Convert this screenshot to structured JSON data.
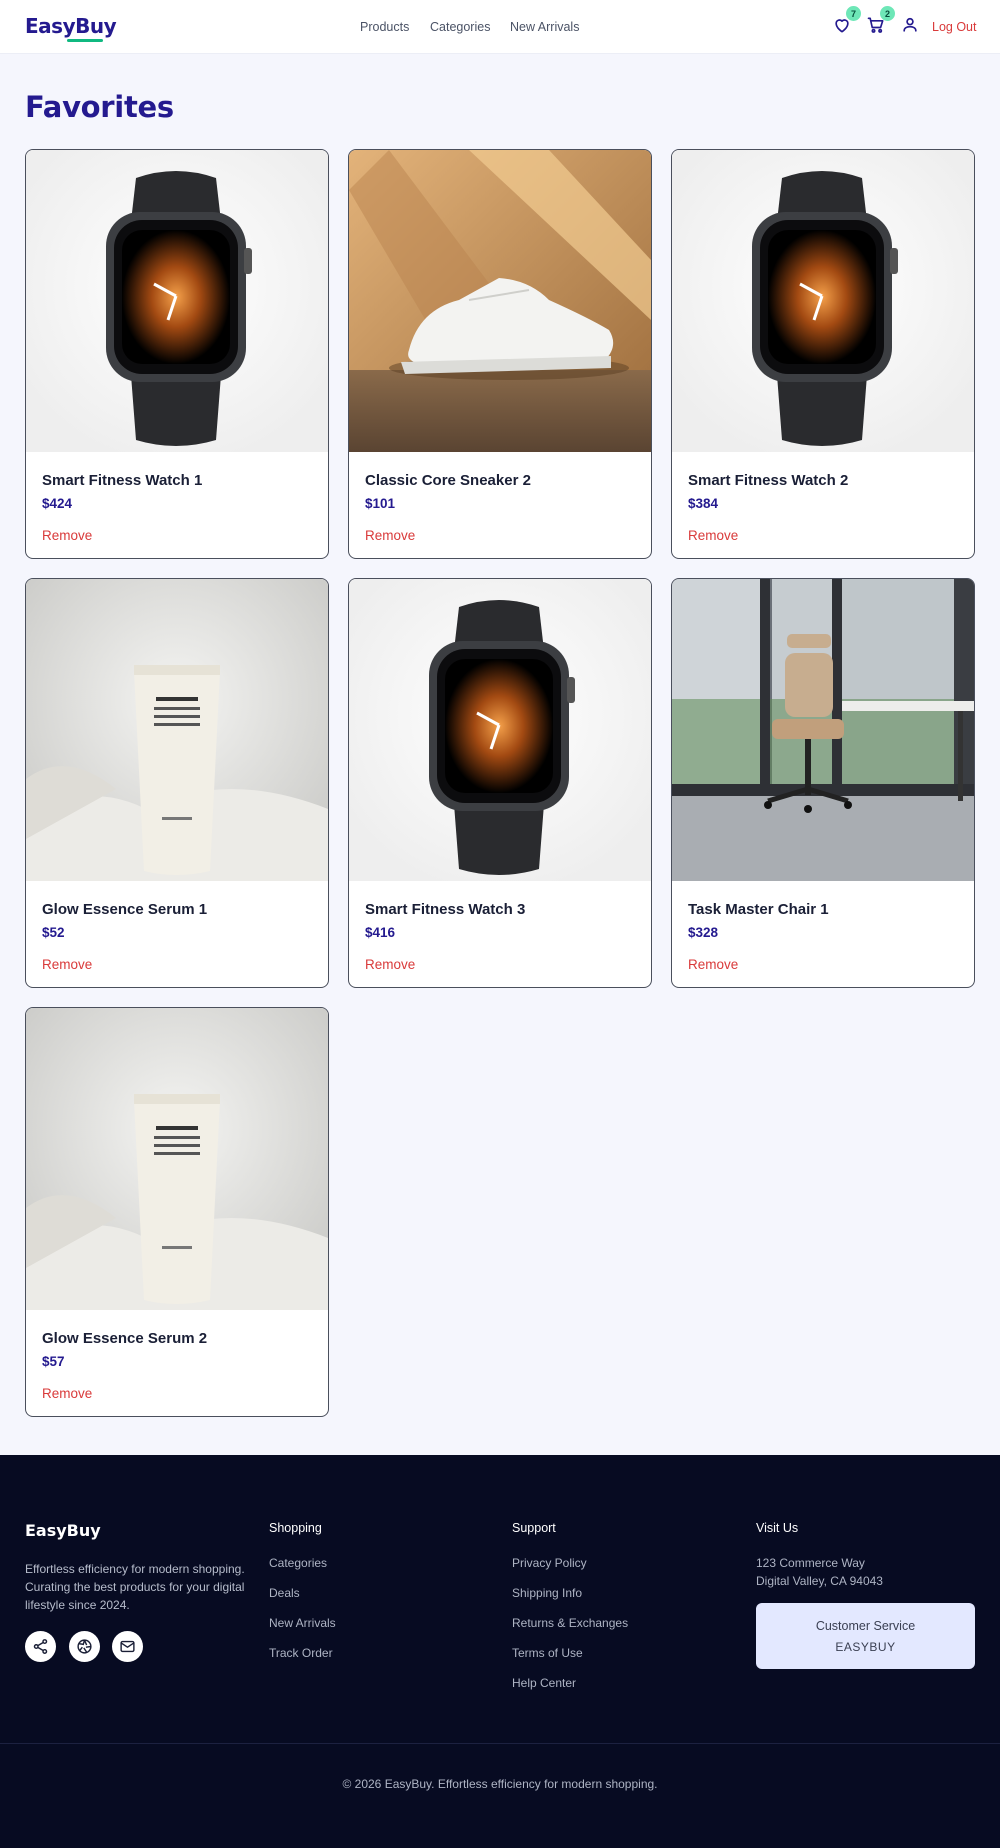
{
  "header": {
    "logo": "EasyBuy",
    "nav": [
      "Products",
      "Categories",
      "New Arrivals"
    ],
    "wishlist_count": "7",
    "cart_count": "2",
    "logout_label": "Log Out",
    "icons": [
      "heart-icon",
      "cart-icon",
      "user-icon"
    ]
  },
  "page": {
    "title": "Favorites"
  },
  "favorites": [
    {
      "name": "Smart Fitness Watch 1",
      "price": "$424",
      "remove": "Remove",
      "image": "watch"
    },
    {
      "name": "Classic Core Sneaker 2",
      "price": "$101",
      "remove": "Remove",
      "image": "sneaker"
    },
    {
      "name": "Smart Fitness Watch 2",
      "price": "$384",
      "remove": "Remove",
      "image": "watch"
    },
    {
      "name": "Glow Essence Serum 1",
      "price": "$52",
      "remove": "Remove",
      "image": "serum"
    },
    {
      "name": "Smart Fitness Watch 3",
      "price": "$416",
      "remove": "Remove",
      "image": "watch"
    },
    {
      "name": "Task Master Chair 1",
      "price": "$328",
      "remove": "Remove",
      "image": "chair"
    },
    {
      "name": "Glow Essence Serum 2",
      "price": "$57",
      "remove": "Remove",
      "image": "serum"
    }
  ],
  "footer": {
    "brand": "EasyBuy",
    "description": "Effortless efficiency for modern shopping. Curating the best products for your digital lifestyle since 2024.",
    "social_icons": [
      "share-icon",
      "aperture-icon",
      "mail-icon"
    ],
    "shopping": {
      "heading": "Shopping",
      "links": [
        "Categories",
        "Deals",
        "New Arrivals",
        "Track Order"
      ]
    },
    "support": {
      "heading": "Support",
      "links": [
        "Privacy Policy",
        "Shipping Info",
        "Returns & Exchanges",
        "Terms of Use",
        "Help Center"
      ]
    },
    "visit": {
      "heading": "Visit Us",
      "address_line1": "123 Commerce Way",
      "address_line2": "Digital Valley, CA 94043"
    },
    "customer_service": {
      "title": "Customer Service",
      "code": "EASYBUY"
    },
    "copyright": "© 2026 EasyBuy. Effortless efficiency for modern shopping."
  },
  "colors": {
    "brand": "#241a8f",
    "accent": "#10b981",
    "danger": "#d93a3a",
    "footer_bg": "#070b22"
  }
}
